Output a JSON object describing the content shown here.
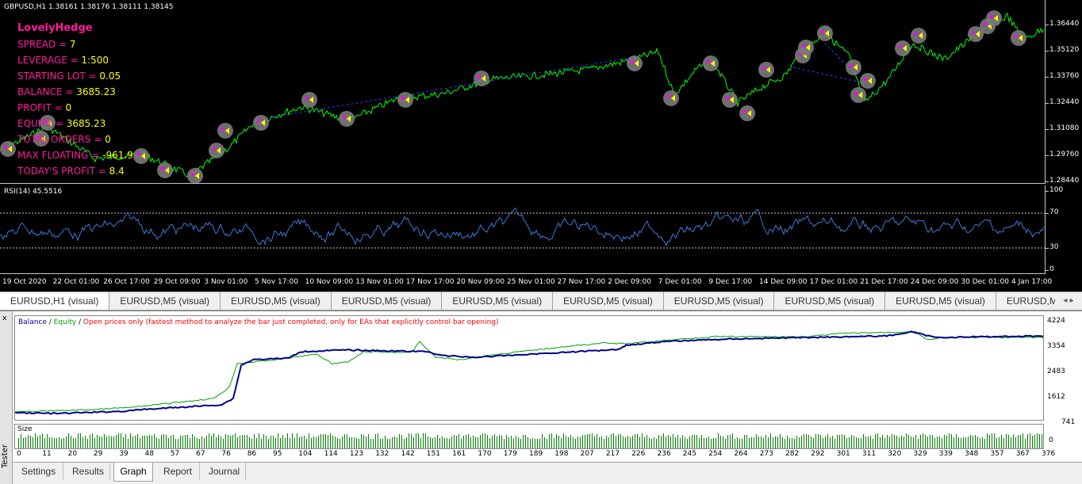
{
  "chart": {
    "title": "GBPUSD,H1  1.38161 1.38176 1.38111 1.38145",
    "expert_name": "LovelyHedge",
    "info_rows": [
      {
        "key": "SPREAD = ",
        "value": "7"
      },
      {
        "key": "LEVERAGE = ",
        "value": "1:500"
      },
      {
        "key": "STARTING LOT = ",
        "value": "0.05"
      },
      {
        "key": "BALANCE = ",
        "value": "3685.23"
      },
      {
        "key": "PROFIT = ",
        "value": "0"
      },
      {
        "key": "EQUITY = ",
        "value": "3685.23"
      },
      {
        "key": "TOTAL ORDERS = ",
        "value": "0"
      },
      {
        "key": "MAX FLOATING = ",
        "value": "-961.9"
      },
      {
        "key": "TODAY'S PROFIT = ",
        "value": "8.4"
      }
    ],
    "price_axis": [
      "1.36440",
      "1.35120",
      "1.33760",
      "1.32440",
      "1.31080",
      "1.29760",
      "1.28440"
    ],
    "rsi_title": "RSI(14) 45.5516",
    "rsi_axis": [
      "100",
      "70",
      "30",
      "0"
    ],
    "time_axis": [
      "19 Oct 2020",
      "22 Oct 01:00",
      "26 Oct 17:00",
      "29 Oct 09:00",
      "3 Nov 01:00",
      "5 Nov 17:00",
      "10 Nov 09:00",
      "13 Nov 01:00",
      "17 Nov 17:00",
      "20 Nov 09:00",
      "25 Nov 01:00",
      "27 Nov 17:00",
      "2 Dec 09:00",
      "7 Dec 01:00",
      "9 Dec 17:00",
      "14 Dec 09:00",
      "17 Dec 01:00",
      "21 Dec 17:00",
      "24 Dec 09:00",
      "30 Dec 01:00",
      "4 Jan 17:00"
    ],
    "colors": {
      "price": "#00ff00",
      "rsi": "#3a7bd5",
      "info_key": "#ff1aa0",
      "info_value": "#ffff00"
    }
  },
  "chart_tabs": [
    "EURUSD,H1 (visual)",
    "EURUSD,M5 (visual)",
    "EURUSD,M5 (visual)",
    "EURUSD,M5 (visual)",
    "EURUSD,M5 (visual)",
    "EURUSD,M5 (visual)",
    "EURUSD,M5 (visual)",
    "EURUSD,M5 (visual)",
    "EURUSD,M5 (visual)",
    "EURUSD,M5 (visual)",
    "EURUS"
  ],
  "tab_scroll": "◂ ▸",
  "tester": {
    "side_label": "Tester",
    "close_icon": "x",
    "legend": {
      "balance": "Balance",
      "sep1": " / ",
      "equity": "Equity",
      "sep2": " / ",
      "note": "Open prices only (fastest method to analyze the bar just completed, only for EAs that explicitly control bar opening)"
    },
    "y_axis": [
      "4224",
      "3354",
      "2483",
      "1612",
      "741"
    ],
    "size_title": "Size",
    "x_axis": [
      "0",
      "11",
      "20",
      "29",
      "39",
      "48",
      "57",
      "67",
      "76",
      "86",
      "95",
      "104",
      "114",
      "123",
      "132",
      "142",
      "151",
      "161",
      "170",
      "179",
      "189",
      "198",
      "207",
      "217",
      "226",
      "236",
      "245",
      "254",
      "264",
      "273",
      "282",
      "292",
      "301",
      "311",
      "320",
      "329",
      "339",
      "348",
      "357",
      "367",
      "376"
    ],
    "tabs": [
      "Settings",
      "Results",
      "Graph",
      "Report",
      "Journal"
    ],
    "active_tab": "Graph",
    "colors": {
      "balance": "#00008b",
      "equity": "#00a000",
      "note": "#ff0000",
      "size": "#008000"
    }
  }
}
